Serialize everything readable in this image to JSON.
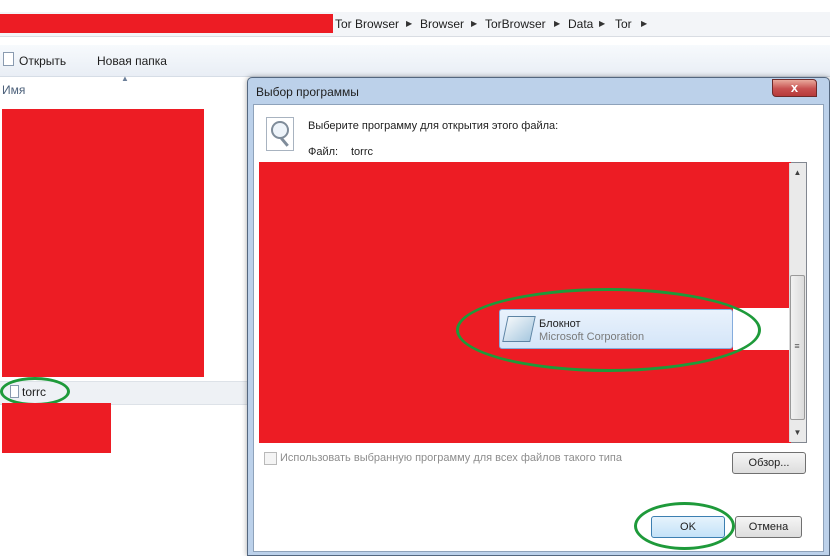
{
  "explorer": {
    "breadcrumbs": [
      "Tor Browser",
      "Browser",
      "TorBrowser",
      "Data",
      "Tor"
    ],
    "toolbar": {
      "open_label": "Открыть",
      "new_folder_label": "Новая папка"
    },
    "column_name": "Имя",
    "file_name": "torrc"
  },
  "dialog": {
    "title": "Выбор программы",
    "close_glyph": "x",
    "prompt": "Выберите программу для открытия этого файла:",
    "file_label": "Файл:",
    "file_value": "torrc",
    "program": {
      "name": "Блокнот",
      "vendor": "Microsoft Corporation"
    },
    "checkbox_label": "Использовать выбранную программу для всех файлов такого типа",
    "checkbox_checked": false,
    "browse_label": "Обзор...",
    "ok_label": "OK",
    "cancel_label": "Отмена"
  },
  "colors": {
    "redaction": "#ed1c24",
    "annotation": "#1e9a3a",
    "selection": "#d4e5f8"
  }
}
